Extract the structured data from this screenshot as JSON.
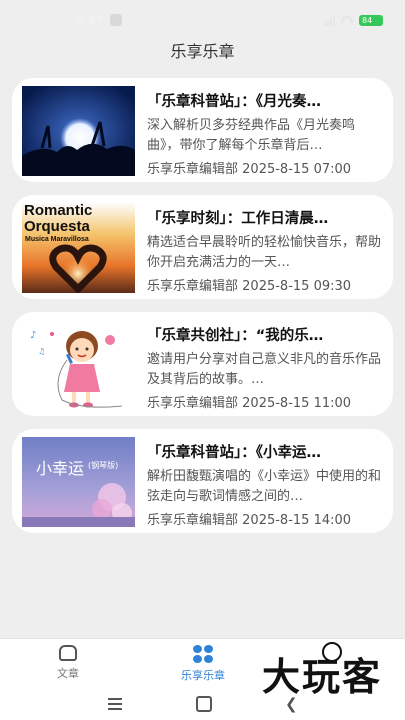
{
  "status": {
    "time": "9:47",
    "battery": "84"
  },
  "header": {
    "title": "乐享乐章"
  },
  "articles": [
    {
      "title": "「乐章科普站」：《月光奏…",
      "desc": "深入解析贝多芬经典作品《月光奏鸣曲》，带你了解每个乐章背后…",
      "author": "乐享乐章编辑部",
      "date": "2025-8-15 07:00",
      "thumb": "moon-tree-night-image"
    },
    {
      "title": "「乐享时刻」：工作日清晨…",
      "desc": "精选适合早晨聆听的轻松愉快音乐，帮助你开启充满活力的一天…",
      "author": "乐享乐章编辑部",
      "date": "2025-8-15 09:30",
      "thumb": "heart-hands-sunset-image",
      "thumb_text": {
        "line1": "Romantic",
        "line2": "Orquesta",
        "line3": "Musica Maravillosa"
      }
    },
    {
      "title": "「乐章共创社」：“我的乐…",
      "desc": "邀请用户分享对自己意义非凡的音乐作品及其背后的故事。…",
      "author": "乐享乐章编辑部",
      "date": "2025-8-15 11:00",
      "thumb": "singing-girl-cartoon-image"
    },
    {
      "title": "「乐章科普站」：《小幸运…",
      "desc": "解析田馥甄演唱的《小幸运》中使用的和弦走向与歌词情感之间的…",
      "author": "乐享乐章编辑部",
      "date": "2025-8-15 14:00",
      "thumb": "xiao-xing-yun-cover-image",
      "thumb_text": {
        "line1": "小幸运",
        "line2": "(钢琴版)"
      }
    }
  ],
  "nav": {
    "items": [
      {
        "label": "文章",
        "icon": "home-icon",
        "active": false
      },
      {
        "label": "乐享乐章",
        "icon": "grid-icon",
        "active": true
      }
    ]
  },
  "watermark": {
    "text": "大玩客"
  },
  "colors": {
    "accent": "#2e83d6",
    "background": "#eeeeee",
    "card": "#ffffff"
  }
}
